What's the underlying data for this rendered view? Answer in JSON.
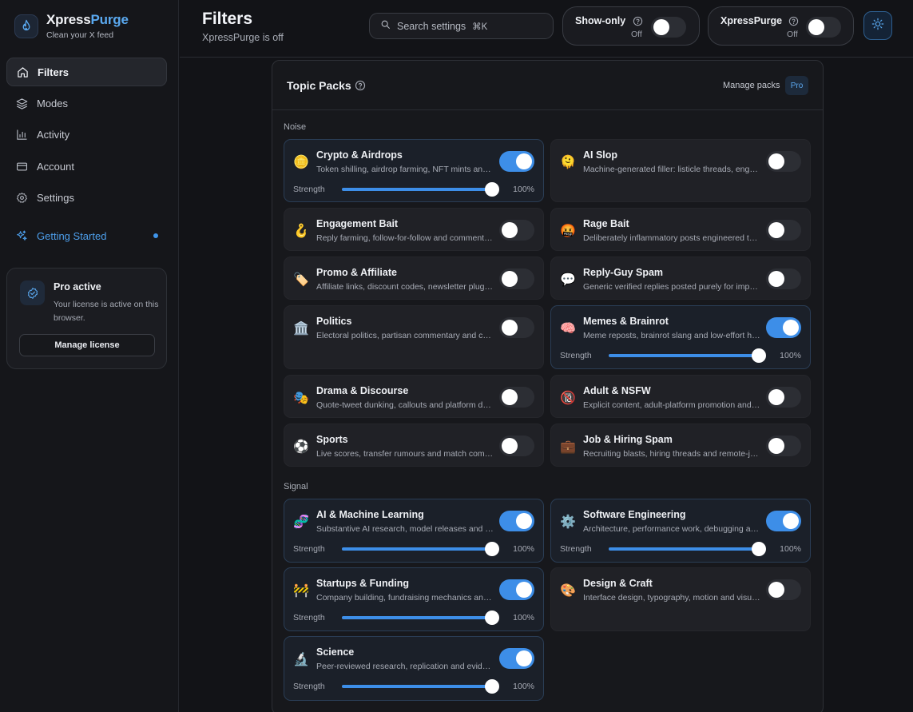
{
  "brand": {
    "name_1": "Xpress",
    "name_2": "Purge",
    "tagline": "Clean your X feed"
  },
  "nav": {
    "filters": "Filters",
    "modes": "Modes",
    "activity": "Activity",
    "account": "Account",
    "settings": "Settings",
    "getting_started": "Getting Started"
  },
  "pro": {
    "title": "Pro active",
    "desc": "Your license is active on this browser.",
    "button": "Manage license"
  },
  "header": {
    "title": "Filters",
    "subtitle": "XpressPurge is off",
    "search_placeholder": "Search settings",
    "search_shortcut": "⌘K",
    "show_only": {
      "label": "Show-only",
      "state": "Off",
      "on": false
    },
    "xpresspurge": {
      "label": "XpressPurge",
      "state": "Off",
      "on": false
    }
  },
  "panel": {
    "title": "Topic Packs",
    "manage": "Manage packs",
    "pro_badge": "Pro",
    "sections": {
      "noise": "Noise",
      "signal": "Signal"
    }
  },
  "strength_label": "Strength",
  "cards": [
    {
      "id": "crypto",
      "emoji": "🪙",
      "title": "Crypto & Airdrops",
      "desc": "Token shilling, airdrop farming, NFT mints and pump-and-dump schemes",
      "on": true,
      "strength": 100,
      "strength_text": "100%"
    },
    {
      "id": "aislop",
      "emoji": "🫠",
      "title": "AI Slop",
      "desc": "Machine-generated filler: listicle threads, engagement-farmed summaries",
      "on": false
    },
    {
      "id": "bait",
      "emoji": "🪝",
      "title": "Engagement Bait",
      "desc": "Reply farming, follow-for-follow and comment-to-win posts",
      "on": false
    },
    {
      "id": "rage",
      "emoji": "🤬",
      "title": "Rage Bait",
      "desc": "Deliberately inflammatory posts engineered to provoke outrage",
      "on": false
    },
    {
      "id": "promo",
      "emoji": "🏷️",
      "title": "Promo & Affiliate",
      "desc": "Affiliate links, discount codes, newsletter plugs and ads",
      "on": false
    },
    {
      "id": "replyguy",
      "emoji": "💬",
      "title": "Reply-Guy Spam",
      "desc": "Generic verified replies posted purely for impressions",
      "on": false
    },
    {
      "id": "politics",
      "emoji": "🏛️",
      "title": "Politics",
      "desc": "Electoral politics, partisan commentary and campaign content",
      "on": false
    },
    {
      "id": "memes",
      "emoji": "🧠",
      "title": "Memes & Brainrot",
      "desc": "Meme reposts, brainrot slang and low-effort humour",
      "on": true,
      "strength": 100,
      "strength_text": "100%"
    },
    {
      "id": "drama",
      "emoji": "🎭",
      "title": "Drama & Discourse",
      "desc": "Quote-tweet dunking, callouts and platform drama",
      "on": false
    },
    {
      "id": "nsfw",
      "emoji": "🔞",
      "title": "Adult & NSFW",
      "desc": "Explicit content, adult-platform promotion and thirst traps",
      "on": false
    },
    {
      "id": "sports",
      "emoji": "⚽",
      "title": "Sports",
      "desc": "Live scores, transfer rumours and match commentary",
      "on": false
    },
    {
      "id": "jobs",
      "emoji": "💼",
      "title": "Job & Hiring Spam",
      "desc": "Recruiting blasts, hiring threads and remote-job spam",
      "on": false
    },
    {
      "id": "ai",
      "emoji": "🧬",
      "title": "AI & Machine Learning",
      "desc": "Substantive AI research, model releases and benchmarks",
      "on": true,
      "strength": 100,
      "strength_text": "100%"
    },
    {
      "id": "swe",
      "emoji": "⚙️",
      "title": "Software Engineering",
      "desc": "Architecture, performance work, debugging and tooling",
      "on": true,
      "strength": 100,
      "strength_text": "100%"
    },
    {
      "id": "startups",
      "emoji": "🚧",
      "title": "Startups & Funding",
      "desc": "Company building, fundraising mechanics and launches",
      "on": true,
      "strength": 100,
      "strength_text": "100%"
    },
    {
      "id": "design",
      "emoji": "🎨",
      "title": "Design & Craft",
      "desc": "Interface design, typography, motion and visual craft",
      "on": false
    },
    {
      "id": "science",
      "emoji": "🔬",
      "title": "Science",
      "desc": "Peer-reviewed research, replication and evidence",
      "on": true,
      "strength": 100,
      "strength_text": "100%"
    }
  ]
}
